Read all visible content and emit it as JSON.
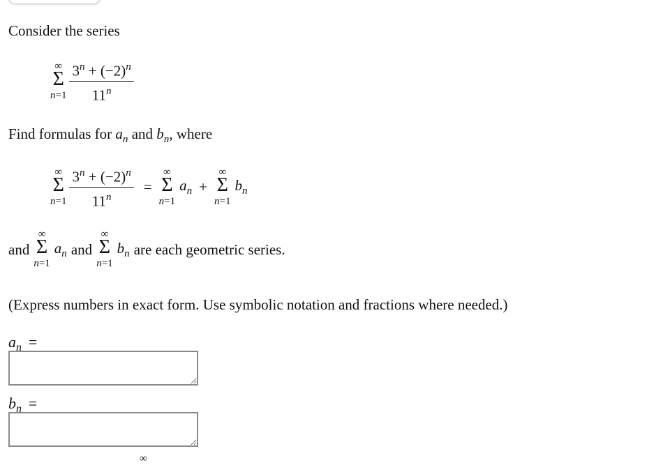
{
  "intro": "Consider the series",
  "series": {
    "upper": "∞",
    "lower_var": "n",
    "lower_eq": "=1",
    "num_base1": "3",
    "exp": "n",
    "plus": "+",
    "num_base2": "(−2)",
    "den_base": "11"
  },
  "find": {
    "prefix": "Find formulas for ",
    "a": "a",
    "b": "b",
    "sub": "n",
    "mid": " and ",
    "suffix": ", where"
  },
  "equation": {
    "equals": "=",
    "plus": "+",
    "a": "a",
    "b": "b",
    "sub": "n"
  },
  "geometric": {
    "and1": "and",
    "and2": "and",
    "suffix": "are each geometric series."
  },
  "instructions": "(Express numbers in exact form. Use symbolic notation and fractions where needed.)",
  "answers": [
    {
      "var": "a",
      "sub": "n",
      "eq": "=",
      "value": ""
    },
    {
      "var": "b",
      "sub": "n",
      "eq": "=",
      "value": ""
    }
  ],
  "partial_next": "∞"
}
